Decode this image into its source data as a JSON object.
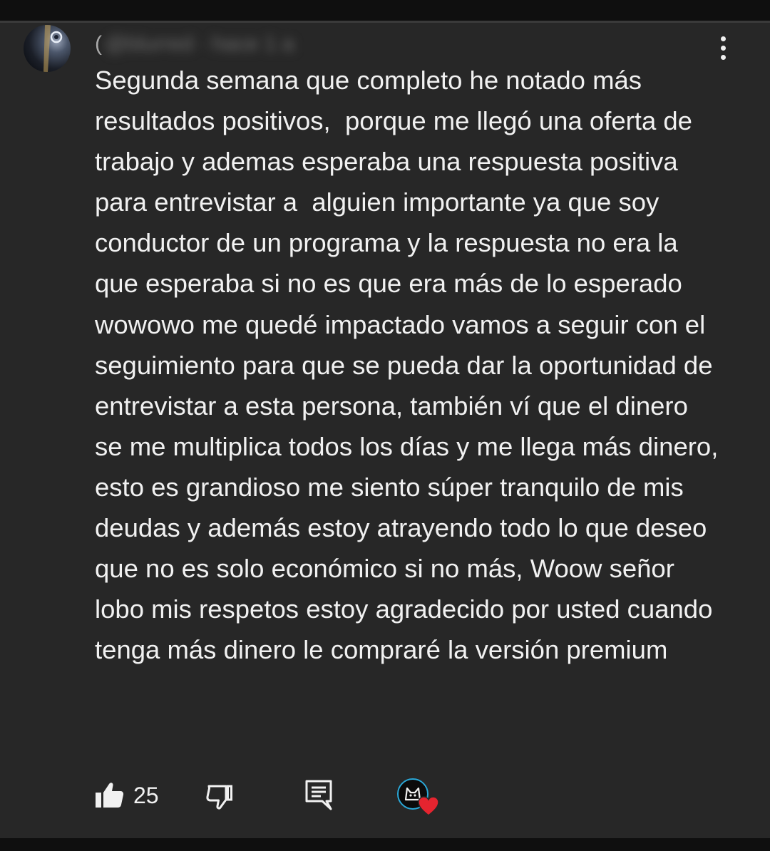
{
  "comment": {
    "author_prefix": "(",
    "author_obscured": "@blurred · hace 1 a",
    "text": "Segunda semana que completo he notado más resultados positivos,  porque me llegó una oferta de trabajo y ademas esperaba una respuesta positiva para entrevistar a  alguien importante ya que soy conductor de un programa y la respuesta no era la que esperaba si no es que era más de lo esperado wowowo me quedé impactado vamos a seguir con el seguimiento para que se pueda dar la oportunidad de entrevistar a esta persona, también ví que el dinero se me multiplica todos los días y me llega más dinero, esto es grandioso me siento súper tranquilo de mis deudas y además estoy atrayendo todo lo que deseo que no es solo económico si no más, Woow señor lobo mis respetos estoy agradecido por usted cuando tenga más dinero le compraré la versión premium",
    "like_count": "25",
    "icons": {
      "like": "thumbs-up-icon",
      "dislike": "thumbs-down-icon",
      "reply": "reply-icon",
      "more": "more-vertical-icon",
      "creator_heart": "heart-icon"
    }
  },
  "colors": {
    "card_background": "#272727",
    "text_primary": "#f1f1f1",
    "text_secondary": "#aaaaaa",
    "heart": "#e5242f",
    "creator_ring": "#2aa8d8"
  }
}
